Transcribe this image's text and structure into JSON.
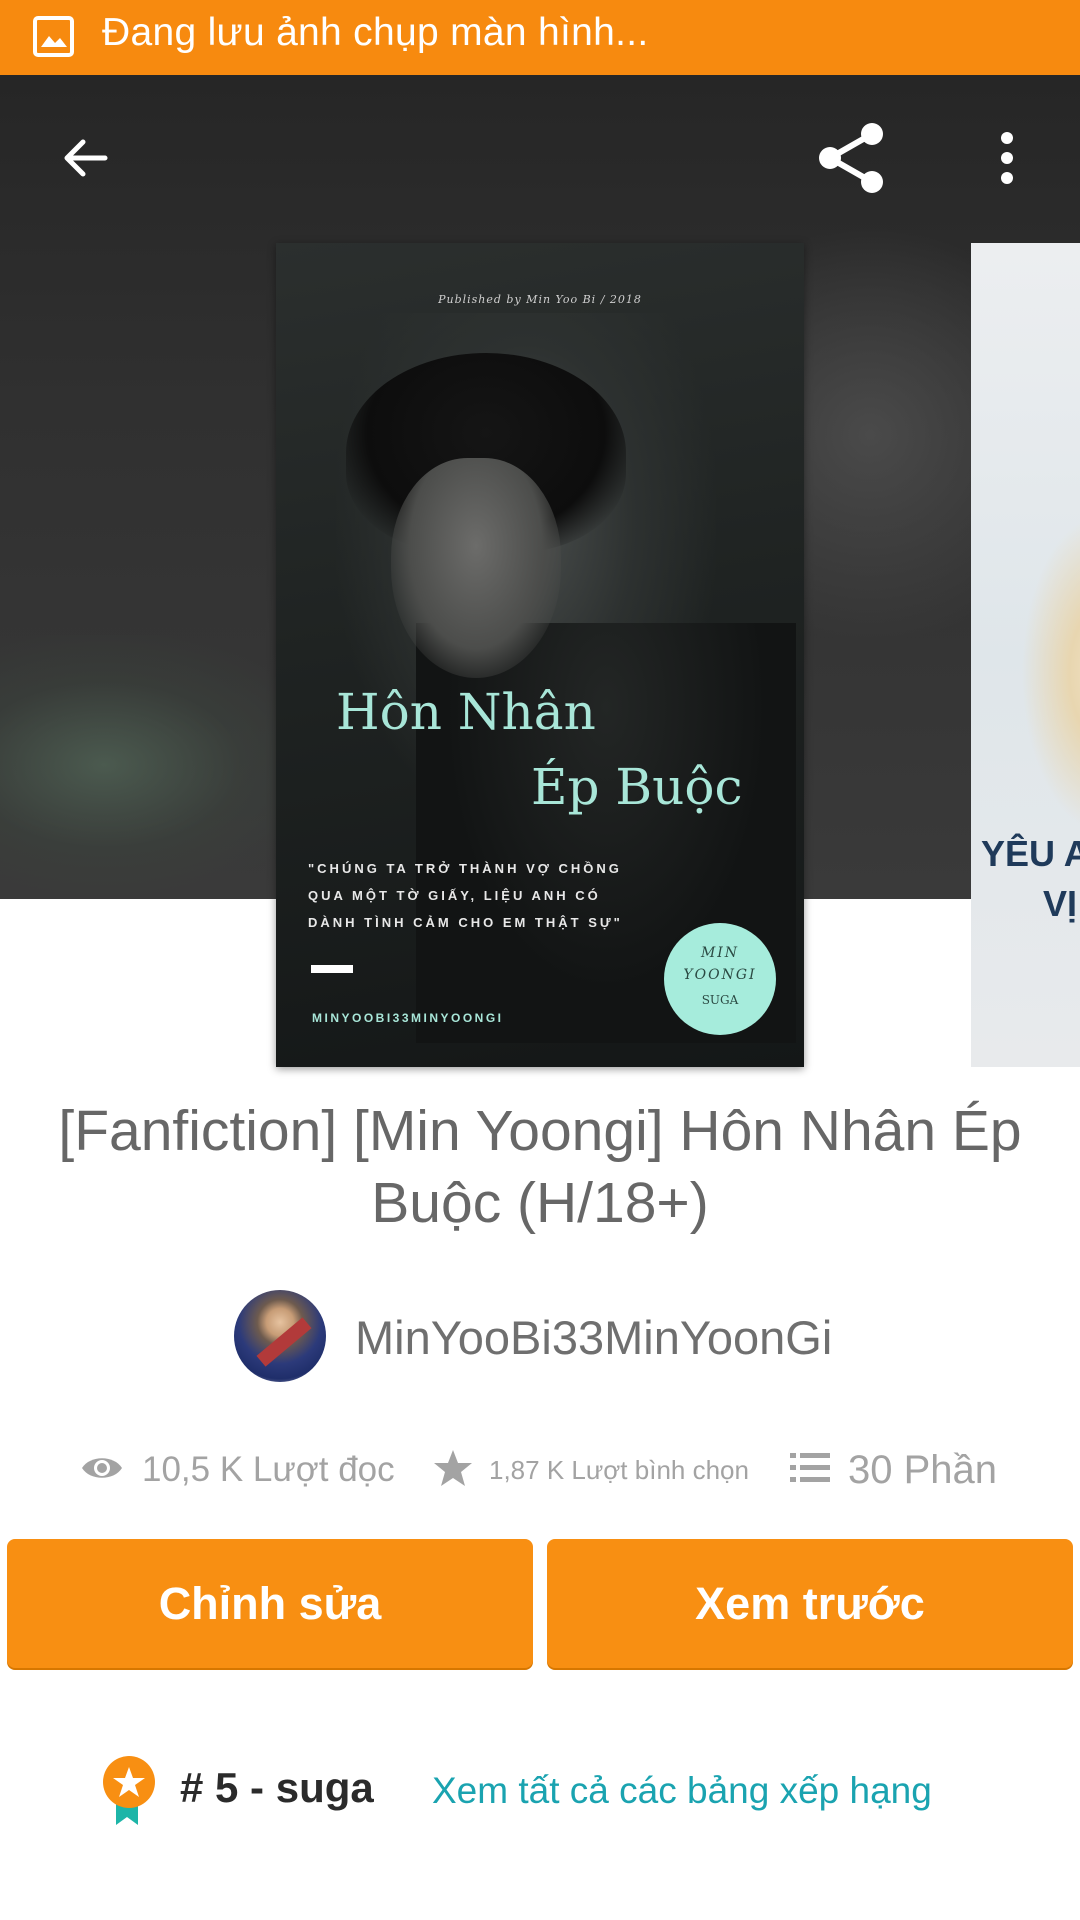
{
  "status_bar": {
    "text": "Đang lưu ảnh chụp màn hình...",
    "icon": "image-icon",
    "background": "#f78a0f"
  },
  "toolbar": {
    "back_icon": "arrow-left-icon",
    "share_icon": "share-icon",
    "more_icon": "more-vert-icon"
  },
  "cover": {
    "published": "Published by Min Yoo Bi / 2018",
    "title_line1": "Hôn Nhân",
    "title_line2": "Ép Buộc",
    "quote_line1": "\"CHÚNG TA TRỞ THÀNH VỢ CHỒNG",
    "quote_line2": "QUA MỘT TỜ GIẤY, LIỆU ANH CÓ",
    "quote_line3": "DÀNH TÌNH CẢM CHO EM THẬT SỰ\"",
    "author": "MINYOOBI33MINYOONGI",
    "badge_line1": "MIN",
    "badge_line2": "YOONGI",
    "badge_line3": "SUGA"
  },
  "next_cover": {
    "text_line1": "YÊU A",
    "text_line2": "VỊ"
  },
  "story": {
    "title": "[Fanfiction] [Min Yoongi] Hôn Nhân Ép Buộc (H/18+)",
    "author": "MinYooBi33MinYoonGi"
  },
  "stats": {
    "reads": "10,5 K Lượt đọc",
    "votes": "1,87 K Lượt bình chọn",
    "parts": "30 Phần",
    "reads_icon": "eye-icon",
    "votes_icon": "star-icon",
    "parts_icon": "list-icon"
  },
  "actions": {
    "edit_label": "Chỉnh sửa",
    "preview_label": "Xem trước",
    "accent": "#f88f12"
  },
  "ranking": {
    "rank_text": "# 5 - suga",
    "link_text": "Xem tất cả các bảng xếp hạng",
    "icon": "ribbon-star-icon",
    "link_color": "#1aa3b0"
  }
}
